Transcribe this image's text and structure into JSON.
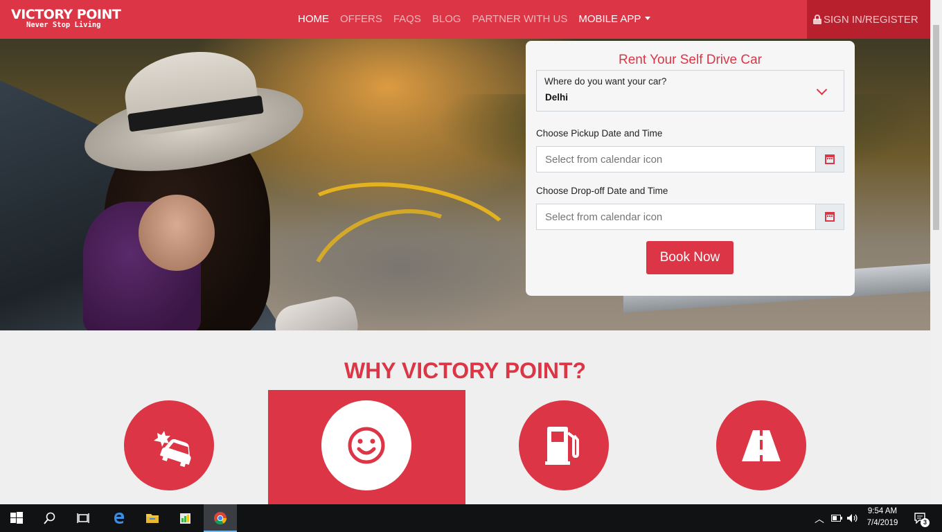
{
  "brand": {
    "title": "VICTORY POINT",
    "tagline": "Never Stop Living"
  },
  "nav": {
    "items": [
      {
        "label": "HOME",
        "active": true
      },
      {
        "label": "OFFERS",
        "active": false
      },
      {
        "label": "FAQS",
        "active": false
      },
      {
        "label": "BLOG",
        "active": false
      },
      {
        "label": "PARTNER WITH US",
        "active": false
      },
      {
        "label": "MOBILE APP",
        "active": true,
        "dropdown": true
      }
    ],
    "signin_label": "SIGN IN/REGISTER",
    "signin_icon": "lock-icon"
  },
  "booking": {
    "title": "Rent Your Self Drive Car",
    "city_label": "Where do you want your car?",
    "city_value": "Delhi",
    "pickup_label": "Choose Pickup Date and Time",
    "pickup_placeholder": "Select from calendar icon",
    "dropoff_label": "Choose Drop-off Date and Time",
    "dropoff_placeholder": "Select from calendar icon",
    "book_label": "Book Now"
  },
  "why": {
    "title": "WHY VICTORY POINT?",
    "features": [
      {
        "icon": "car-crash-icon"
      },
      {
        "icon": "smile-icon",
        "active": true
      },
      {
        "icon": "gas-pump-icon"
      },
      {
        "icon": "road-icon"
      }
    ]
  },
  "taskbar": {
    "time": "9:54 AM",
    "date": "7/4/2019",
    "notification_count": "3"
  },
  "colors": {
    "accent": "#dc3545",
    "accent_dark": "#b8202d",
    "background": "#efefef"
  }
}
